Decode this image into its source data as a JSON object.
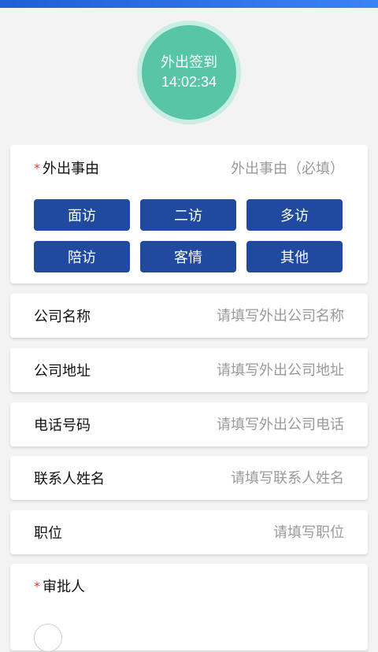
{
  "checkin": {
    "title": "外出签到",
    "time": "14:02:34"
  },
  "reason": {
    "label": "外出事由",
    "hint": "外出事由（必填）",
    "options": [
      "面访",
      "二访",
      "多访",
      "陪访",
      "客情",
      "其他"
    ]
  },
  "company_name": {
    "label": "公司名称",
    "placeholder": "请填写外出公司名称"
  },
  "company_address": {
    "label": "公司地址",
    "placeholder": "请填写外出公司地址"
  },
  "phone": {
    "label": "电话号码",
    "placeholder": "请填写外出公司电话"
  },
  "contact": {
    "label": "联系人姓名",
    "placeholder": "请填写联系人姓名"
  },
  "position": {
    "label": "职位",
    "placeholder": "请填写职位"
  },
  "approver": {
    "label": "审批人"
  },
  "required_mark": "*",
  "colors": {
    "accent": "#1f4aa0",
    "checkin": "#58c6a6",
    "required": "#e53935"
  }
}
